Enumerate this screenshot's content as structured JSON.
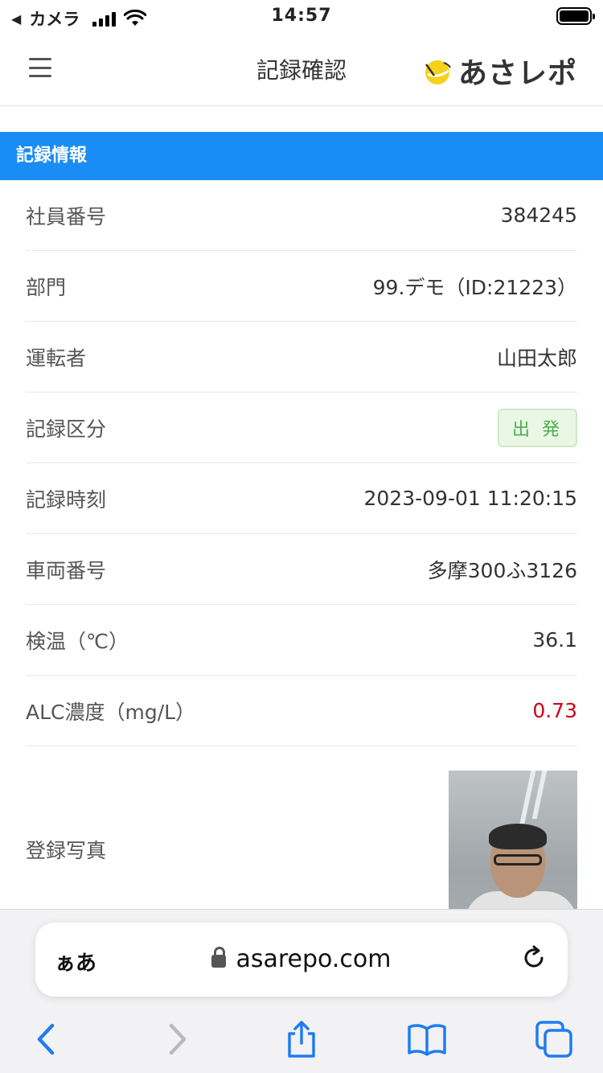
{
  "status_bar": {
    "back_app": "カメラ",
    "time": "14:57",
    "back_icon": "back-triangle-icon"
  },
  "header": {
    "title": "記録確認",
    "brand": "あさレポ"
  },
  "section": {
    "title": "記録情報"
  },
  "rows": [
    {
      "label": "社員番号",
      "value": "384245"
    },
    {
      "label": "部門",
      "value": "99.デモ（ID:21223）"
    },
    {
      "label": "運転者",
      "value": "山田太郎"
    },
    {
      "label": "記録区分",
      "value": "出 発"
    },
    {
      "label": "記録時刻",
      "value": "2023-09-01 11:20:15"
    },
    {
      "label": "車両番号",
      "value": "多摩300ふ3126"
    },
    {
      "label": "検温（℃）",
      "value": "36.1"
    },
    {
      "label": "ALC濃度（mg/L）",
      "value": "0.73"
    },
    {
      "label": "登録写真"
    }
  ],
  "colors": {
    "accent": "#1a8cf5",
    "alert": "#d0021b",
    "badge_text": "#4caf50",
    "safari_blue": "#1f7cf0"
  },
  "browser": {
    "aa_label": "ぁあ",
    "url": "asarepo.com"
  }
}
